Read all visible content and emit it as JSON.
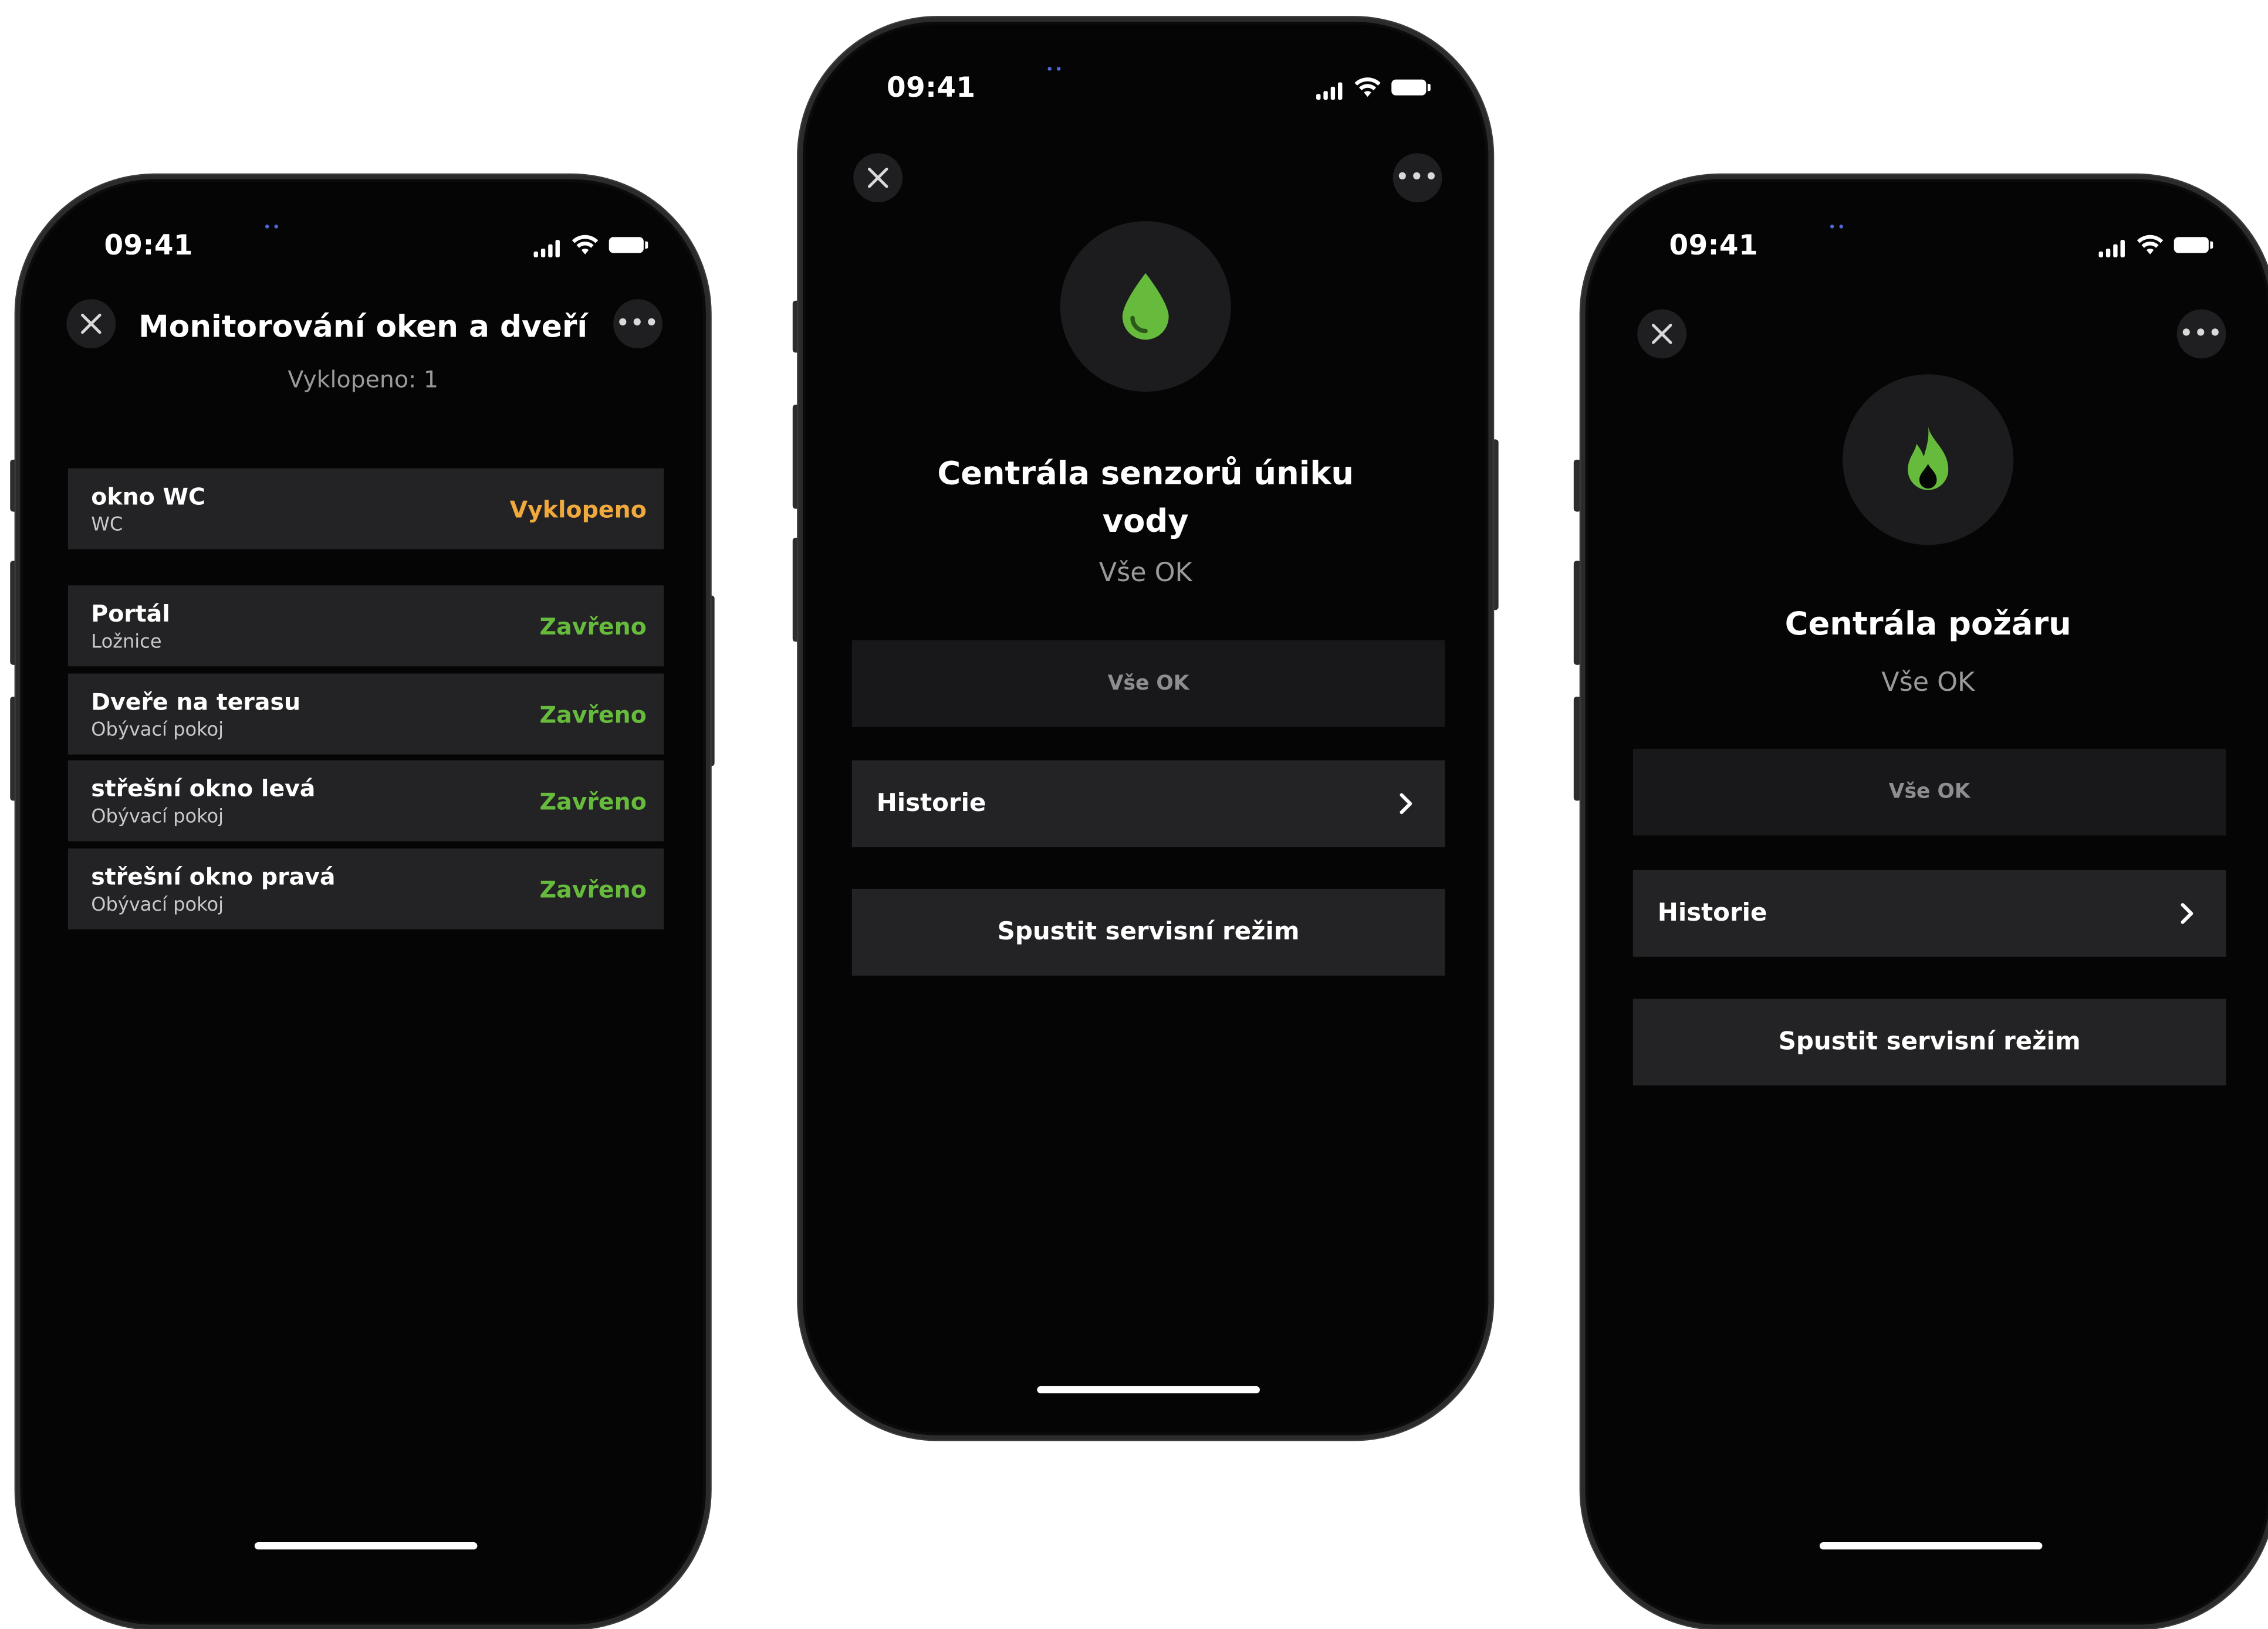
{
  "colors": {
    "background": "#ffffff",
    "screen": "#000000",
    "card": "#232325",
    "ok_green": "#66bb3c",
    "warn_amber": "#f0a93c",
    "muted": "#9a9a9c"
  },
  "phone1": {
    "time": "09:41",
    "title": "Monitorování oken a dveří",
    "subtitle": "Vyklopeno: 1",
    "items": [
      {
        "name": "okno WC",
        "room": "WC",
        "status": "Vyklopeno"
      },
      {
        "name": "Portál",
        "room": "Ložnice",
        "status": "Zavřeno"
      },
      {
        "name": "Dveře na terasu",
        "room": "Obývací pokoj",
        "status": "Zavřeno"
      },
      {
        "name": "střešní okno levá",
        "room": "Obývací pokoj",
        "status": "Zavřeno"
      },
      {
        "name": "střešní okno pravá",
        "room": "Obývací pokoj",
        "status": "Zavřeno"
      }
    ],
    "icons": {
      "close": "close-icon",
      "more": "more-icon"
    }
  },
  "phone2": {
    "time": "09:41",
    "icon": "water-drop-icon",
    "title_line1": "Centrála senzorů úniku",
    "title_line2": "vody",
    "subtitle": "Vše OK",
    "status_panel": "Vše OK",
    "history_label": "Historie",
    "service_label": "Spustit servisní režim"
  },
  "phone3": {
    "time": "09:41",
    "icon": "flame-icon",
    "title": "Centrála požáru",
    "subtitle": "Vše OK",
    "status_panel": "Vše OK",
    "history_label": "Historie",
    "service_label": "Spustit servisní režim"
  }
}
